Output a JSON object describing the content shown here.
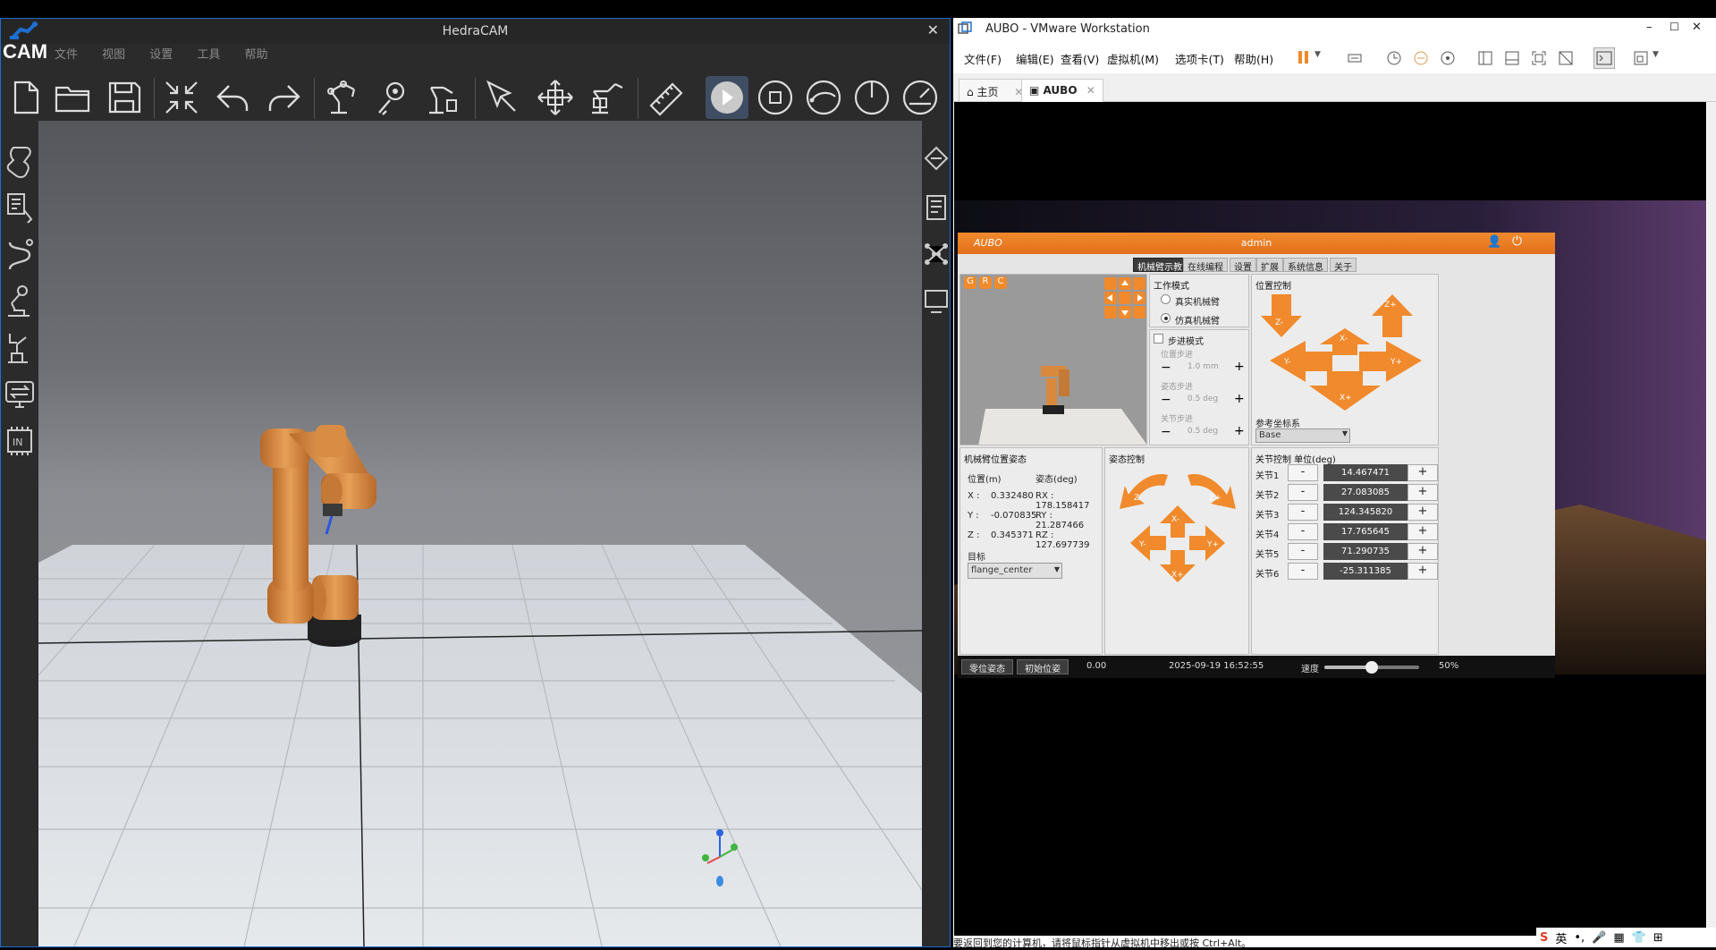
{
  "hedra": {
    "title": "HedraCAM",
    "logo_text": "CAM",
    "close": "✕",
    "menu": [
      "文件",
      "视图",
      "设置",
      "工具",
      "帮助"
    ]
  },
  "vm": {
    "title": "AUBO - VMware Workstation",
    "menu": [
      "文件(F)",
      "编辑(E)",
      "查看(V)",
      "虚拟机(M)",
      "选项卡(T)",
      "帮助(H)"
    ],
    "tabs": [
      {
        "label": "主页"
      },
      {
        "label": "AUBO"
      }
    ],
    "status": "要返回到您的计算机，请将鼠标指针从虚拟机中移出或按 Ctrl+Alt。",
    "controls": {
      "min": "–",
      "max": "☐",
      "close": "✕"
    }
  },
  "aubo": {
    "logo": "AUBO",
    "user": "admin",
    "tabs": [
      "机械臂示教",
      "在线编程",
      "设置",
      "扩展",
      "系统信息",
      "关于"
    ],
    "view_buttons": [
      "G",
      "R",
      "C"
    ],
    "work_mode": {
      "title": "工作模式",
      "options": [
        "真实机械臂",
        "仿真机械臂"
      ],
      "selected": "仿真机械臂"
    },
    "step_mode": {
      "label": "步进模式",
      "position_step_label": "位置步进",
      "position_step": "1.0 mm",
      "pose_step_label": "姿态步进",
      "pose_step": "0.5 deg",
      "joint_step_label": "关节步进",
      "joint_step": "0.5 deg"
    },
    "position_control": {
      "title": "位置控制",
      "arrows": [
        "Z-",
        "Z+",
        "X-",
        "Y-",
        "Y+",
        "X+"
      ],
      "ref_frame_label": "参考坐标系",
      "ref_frame": "Base"
    },
    "pose": {
      "title": "机械臂位置姿态",
      "pos_header": "位置(m)",
      "rot_header": "姿态(deg)",
      "x_label": "X :",
      "x": "0.332480",
      "y_label": "Y :",
      "y": "-0.070835",
      "z_label": "Z :",
      "z": "0.345371",
      "rx": "RX : 178.158417",
      "ry": "RY : 21.287466",
      "rz": "RZ : 127.697739",
      "target_label": "目标",
      "target": "flange_center"
    },
    "orientation_control": {
      "title": "姿态控制",
      "arrows": [
        "Z-",
        "Z+",
        "X-",
        "Y-",
        "Y+",
        "X+"
      ]
    },
    "joint_control": {
      "title": "关节控制 单位(deg)",
      "joints": [
        {
          "label": "关节1",
          "value": "14.467471"
        },
        {
          "label": "关节2",
          "value": "27.083085"
        },
        {
          "label": "关节3",
          "value": "124.345820"
        },
        {
          "label": "关节4",
          "value": "17.765645"
        },
        {
          "label": "关节5",
          "value": "71.290735"
        },
        {
          "label": "关节6",
          "value": "-25.311385"
        }
      ],
      "minus": "-",
      "plus": "+"
    },
    "footer": {
      "zero_pose": "零位姿态",
      "init_pose": "初始位姿",
      "value": "0.00",
      "datetime": "2025-09-19 16:52:55",
      "speed_label": "速度",
      "speed": 0.5,
      "speed_text": "50%"
    }
  },
  "ime": [
    "S",
    "英",
    "•,",
    "🎤",
    "▦",
    "👕",
    "⊞"
  ],
  "colors": {
    "aubo_orange": "#f08a2c",
    "arm_orange": "#d9893d",
    "accent_blue": "#1e6fd0"
  }
}
